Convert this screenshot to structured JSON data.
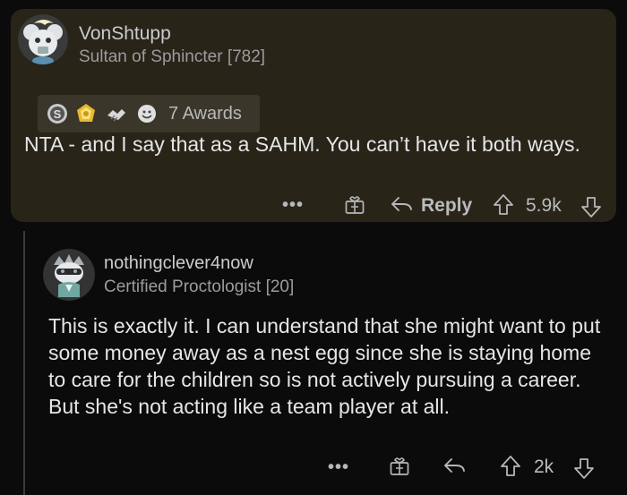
{
  "comment1": {
    "username": "VonShtupp",
    "flair": "Sultan of Sphincter [782]",
    "awards_label": "7 Awards",
    "award_icons": [
      "silver-award-icon",
      "helpful-award-icon",
      "handshake-award-icon",
      "wholesome-award-icon"
    ],
    "body": "NTA - and I say that as a SAHM.  You can’t have it both ways.",
    "actions": {
      "reply_label": "Reply",
      "score": "5.9k"
    }
  },
  "comment2": {
    "username": "nothingclever4now",
    "flair": "Certified Proctologist [20]",
    "body": "This is exactly it. I can understand that she might want to put some money away as a nest egg since she is staying home to care for the children so is not actively pursuing a career. But she's not acting like a team player at all.",
    "actions": {
      "score": "2k"
    }
  },
  "colors": {
    "page_bg": "#0b0b0b",
    "highlight_bg": "#282418",
    "awards_bg": "#3a3629"
  }
}
